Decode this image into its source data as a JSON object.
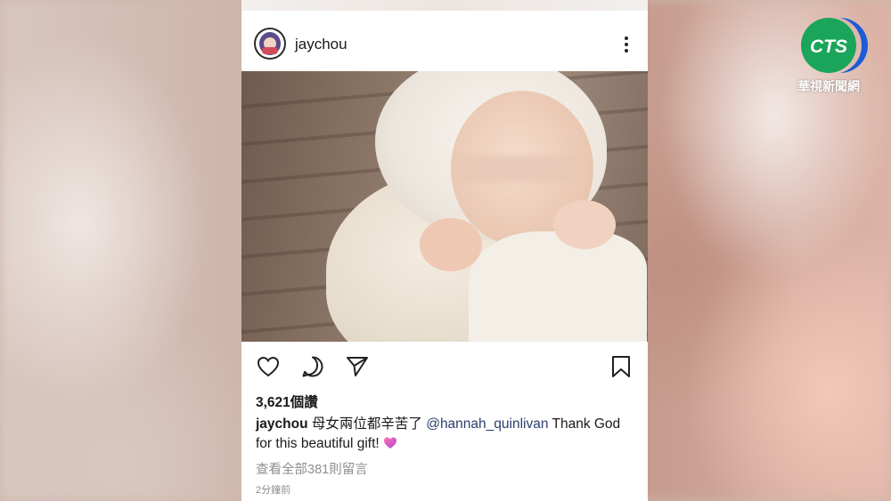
{
  "post": {
    "username": "jaychou",
    "likes": "3,621個讚",
    "caption_user": "jaychou",
    "caption_text": " 母女兩位都辛苦了 ",
    "caption_mention": "@hannah_quinlivan",
    "caption_tail": "  Thank God for this beautiful gift! ",
    "caption_emoji": "sparkling-heart",
    "view_comments": "查看全部381則留言",
    "timestamp": "2分鐘前"
  },
  "icons": {
    "more": "more-vertical-icon",
    "like": "heart-icon",
    "comment": "comment-icon",
    "share": "send-icon",
    "save": "bookmark-icon"
  },
  "broadcaster": {
    "logo_text": "CTS",
    "caption": "華視新聞網",
    "logo_color": "#1aa55a",
    "logo_accent": "#1f5bd6"
  },
  "colors": {
    "mention": "#2a3f6d",
    "secondary_text": "#8e8e8e"
  }
}
